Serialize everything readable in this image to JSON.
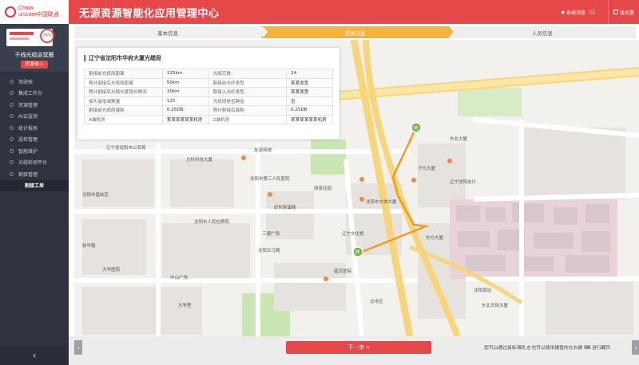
{
  "brand": {
    "line1": "China",
    "line2": "unicom中国联通"
  },
  "header": {
    "title": "无源资源智能化应用管理中心",
    "notice": "系统消息（5）",
    "logout": "退出登"
  },
  "user": {
    "percent": "78%",
    "name": "干线光缆运营圈",
    "role": "资源录入"
  },
  "sidebar": {
    "items": [
      {
        "label": "驾驶舱"
      },
      {
        "label": "集成工作台"
      },
      {
        "label": "资源管理"
      },
      {
        "label": "AI云监测"
      },
      {
        "label": "统计报表"
      },
      {
        "label": "巡检管理"
      },
      {
        "label": "智能维护"
      },
      {
        "label": "光缆检测平台"
      },
      {
        "label": "割接管理"
      },
      {
        "label": "割接工单"
      }
    ],
    "collapse": "‹"
  },
  "steps": [
    {
      "label": "基本信息",
      "state": "done"
    },
    {
      "label": "资源信息",
      "state": "active"
    },
    {
      "label": "人员信息",
      "state": "todo"
    }
  ],
  "panel": {
    "title": "辽宁省沈阳市华府大厦光缆段",
    "rows": [
      [
        "割接前光缆段距离",
        "125km",
        "光缆芯数",
        "24"
      ],
      [
        "预计割接后光缆段距离",
        "50km",
        "割接前光纤类型",
        "某某类型"
      ],
      [
        "预计割接后光缆长度增长情况",
        "10km",
        "割接入光纤类型",
        "某某类型"
      ],
      [
        "接头盒增减数量",
        "125",
        "光缆段是否跨省",
        "否"
      ],
      [
        "割接前光缆段衰耗",
        "0.25DB",
        "预计割接后衰耗",
        "0.25DB"
      ],
      [
        "A端机房",
        "某某某某某某机房",
        "Z端机房",
        "某某某某某某机房"
      ]
    ]
  },
  "map": {
    "labels": [
      {
        "text": "辽宁省沈阳市公安局"
      },
      {
        "text": "方科科技大厦"
      },
      {
        "text": "沈阳市皇姑区"
      },
      {
        "text": "沈阳市第三人民医院"
      },
      {
        "text": "友谊商城"
      },
      {
        "text": "丽景花园"
      },
      {
        "text": "东北大厦"
      },
      {
        "text": "汗元大厦"
      },
      {
        "text": "沈阳市文体大厦"
      },
      {
        "text": "沈阳市人民检察院"
      },
      {
        "text": "好利来蛋糕"
      },
      {
        "text": "三德广场"
      },
      {
        "text": "辽宁沈阳支行"
      },
      {
        "text": "辽宁文化馆"
      },
      {
        "text": "东方大厦"
      },
      {
        "text": "盛京医院"
      },
      {
        "text": "沈阳五马路"
      },
      {
        "text": "中山广场"
      },
      {
        "text": "大学医院"
      },
      {
        "text": "北市区"
      },
      {
        "text": "沈阳南站"
      },
      {
        "text": "东北天街大厦"
      },
      {
        "text": "大学里"
      },
      {
        "text": "新华路"
      }
    ],
    "markers": [
      {
        "text": "始"
      },
      {
        "text": "终"
      }
    ]
  },
  "bottom": {
    "next": "下一步 »",
    "hint": "您可以通过鼠标滑轮 🖱 也可以使用键盘的左右键 ⌨ 进行翻页"
  },
  "colors": {
    "accent": "#e54848",
    "step_active": "#f7b23b",
    "route": "#f29b1d",
    "sidebar": "#2f3340"
  },
  "icons": {
    "bell": "bell-icon",
    "logout": "logout-icon",
    "prev": "chevron-left-icon",
    "next": "chevron-right-icon"
  }
}
